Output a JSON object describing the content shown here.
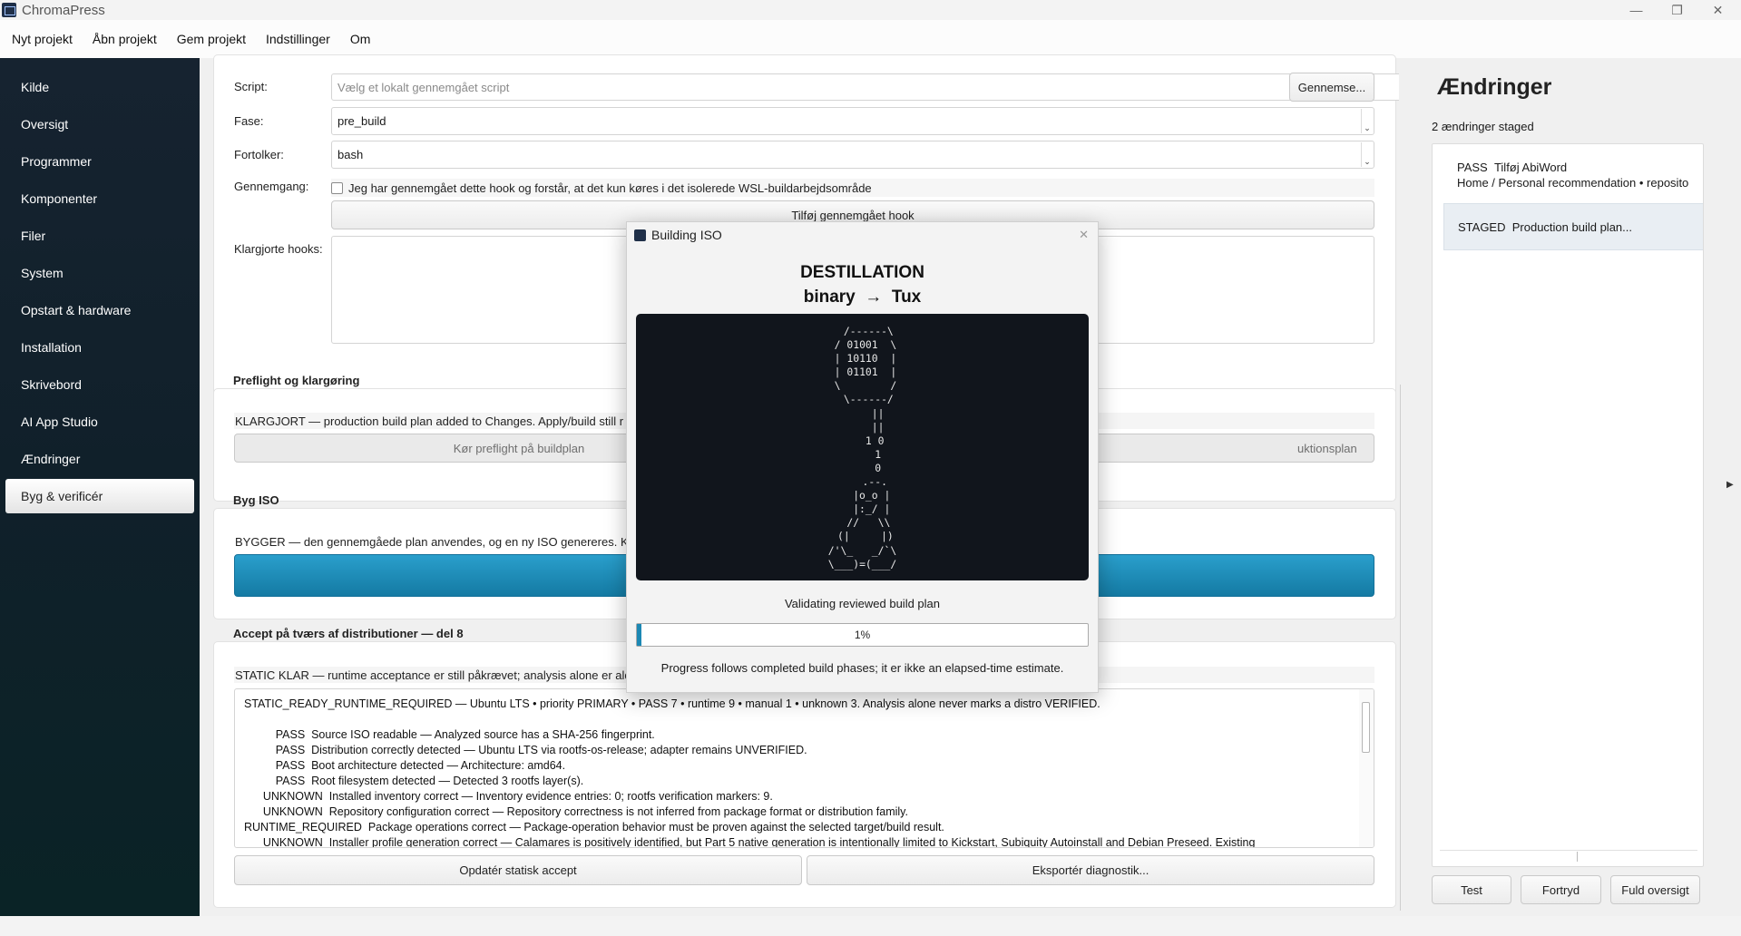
{
  "window": {
    "title": "ChromaPress",
    "minimize": "—",
    "maximize": "❐",
    "close": "✕"
  },
  "menu": [
    "Nyt projekt",
    "Åbn projekt",
    "Gem projekt",
    "Indstillinger",
    "Om"
  ],
  "sidebar": {
    "items": [
      "Kilde",
      "Oversigt",
      "Programmer",
      "Komponenter",
      "Filer",
      "System",
      "Opstart & hardware",
      "Installation",
      "Skrivebord",
      "AI App Studio",
      "Ændringer",
      "Byg & verificér"
    ],
    "active_index": 11
  },
  "hooks": {
    "script_label": "Script:",
    "script_placeholder": "Vælg et lokalt gennemgået script",
    "browse_button": "Gennemse...",
    "phase_label": "Fase:",
    "phase_value": "pre_build",
    "interpreter_label": "Fortolker:",
    "interpreter_value": "bash",
    "review_label": "Gennemgang:",
    "review_checkbox": "Jeg har gennemgået dette hook og forstår, at det kun køres i det isolerede WSL-buildarbejdsområde",
    "add_button": "Tilføj gennemgået hook",
    "prepared_label": "Klargjorte hooks:"
  },
  "preflight": {
    "title": "Preflight og klargøring",
    "status": "KLARGJORT — production build plan added to Changes. Apply/build still r",
    "run_button": "Kør preflight på buildplan",
    "second_button_fragment": "uktionsplan"
  },
  "build": {
    "title": "Byg ISO",
    "status": "BYGGER — den gennemgåede plan anvendes, og en ny ISO genereres. Ki"
  },
  "accept": {
    "title": "Accept på tværs af distributioner — del 8",
    "status": "STATIC KLAR — runtime acceptance er still påkrævet; analysis alone er aldr",
    "log": [
      "STATIC_READY_RUNTIME_REQUIRED — Ubuntu LTS • priority PRIMARY • PASS 7 • runtime 9 • manual 1 • unknown 3. Analysis alone never marks a distro VERIFIED.",
      "",
      "          PASS  Source ISO readable — Analyzed source has a SHA-256 fingerprint.",
      "          PASS  Distribution correctly detected — Ubuntu LTS via rootfs-os-release; adapter remains UNVERIFIED.",
      "          PASS  Boot architecture detected — Architecture: amd64.",
      "          PASS  Root filesystem detected — Detected 3 rootfs layer(s).",
      "      UNKNOWN  Installed inventory correct — Inventory evidence entries: 0; rootfs verification markers: 9.",
      "      UNKNOWN  Repository configuration correct — Repository correctness is not inferred from package format or distribution family.",
      "RUNTIME_REQUIRED  Package operations correct — Package-operation behavior must be proven against the selected target/build result.",
      "      UNKNOWN  Installer profile generation correct — Calamares is positively identified, but Part 5 native generation is intentionally limited to Kickstart, Subiquity Autoinstall and Debian Preseed. Existing"
    ],
    "update_button": "Opdatér statisk accept",
    "export_button": "Eksportér diagnostik..."
  },
  "dialog": {
    "title": "Building ISO",
    "heading": "DESTILLATION",
    "subheading": "binary  →  Tux",
    "ascii": "  /------\\\n / 01001  \\\n | 10110  |\n | 01101  |\n \\        /\n  \\------/\n     ||\n     ||\n    1 0\n     1\n     0\n    .--.\n   |o_o |\n   |:_/ |\n  //   \\\\\n (|     |)\n/'\\_   _/`\\\n\\___)=(___/",
    "status": "Validating reviewed build plan",
    "progress": 1,
    "progress_label": "1%",
    "footnote": "Progress follows completed build phases; it er ikke an elapsed-time estimate.",
    "close": "✕"
  },
  "changes": {
    "title": "Ændringer",
    "count": "2 ændringer staged",
    "items": [
      {
        "badge": "PASS",
        "title": "Tilføj AbiWord",
        "path": "Home / Personal recommendation • reposito"
      },
      {
        "badge": "STAGED",
        "title": "Production build plan..."
      }
    ],
    "test_button": "Test",
    "undo_button": "Fortryd",
    "overview_button": "Fuld oversigt"
  },
  "colors": {
    "accent": "#1c88b4",
    "sidebar": "#122530",
    "dialog_dark": "#11151c"
  }
}
